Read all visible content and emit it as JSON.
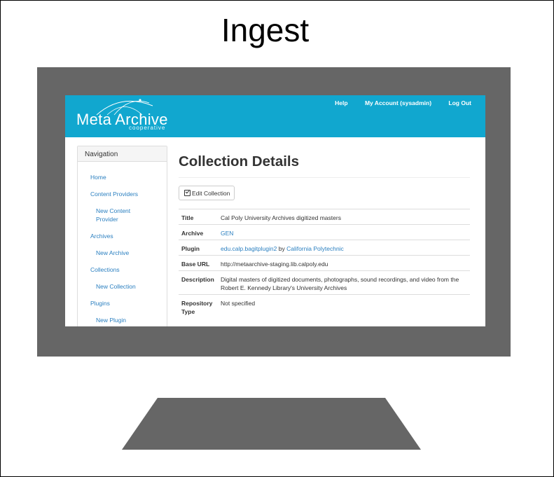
{
  "slide": {
    "title": "Ingest"
  },
  "header": {
    "logo_main": "Meta Archive",
    "logo_sub": "cooperative",
    "nav": [
      "Help",
      "My Account (sysadmin)",
      "Log Out"
    ]
  },
  "sidebar": {
    "heading": "Navigation",
    "items": [
      {
        "label": "Home",
        "indent": false
      },
      {
        "label": "Content Providers",
        "indent": false
      },
      {
        "label": "New Content Provider",
        "indent": true
      },
      {
        "label": "Archives",
        "indent": false
      },
      {
        "label": "New Archive",
        "indent": true
      },
      {
        "label": "Collections",
        "indent": false
      },
      {
        "label": "New Collection",
        "indent": true
      },
      {
        "label": "Plugins",
        "indent": false
      },
      {
        "label": "New Plugin",
        "indent": true
      }
    ]
  },
  "main": {
    "heading": "Collection Details",
    "edit_button": "Edit Collection",
    "details": {
      "title_label": "Title",
      "title_value": "Cal Poly University Archives digitized masters",
      "archive_label": "Archive",
      "archive_value": "GEN",
      "plugin_label": "Plugin",
      "plugin_name": "edu.calp.bagitplugin2",
      "plugin_by": "by",
      "plugin_author": "California Polytechnic",
      "base_url_label": "Base URL",
      "base_url_value": "http://metaarchive-staging.lib.calpoly.edu",
      "description_label": "Description",
      "description_line1": "Digital masters of digitized documents, photographs, sound recordings, and video from the",
      "description_line2": "Robert E. Kennedy Library's University Archives",
      "repo_label_1": "Repository",
      "repo_label_2": "Type",
      "repo_value": "Not specified"
    }
  },
  "colors": {
    "header_bg": "#11a7cf",
    "link": "#2a7fc0",
    "device_gray": "#666666"
  }
}
